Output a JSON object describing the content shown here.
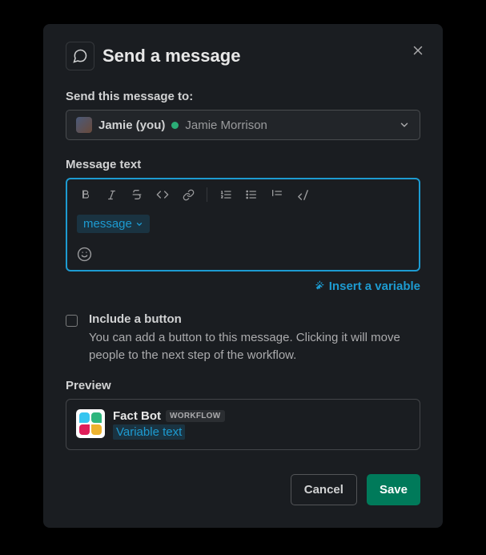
{
  "header": {
    "title": "Send a message"
  },
  "fields": {
    "recipient_label": "Send this message to:",
    "message_label": "Message text"
  },
  "recipient": {
    "display_name": "Jamie (you)",
    "full_name": "Jamie Morrison"
  },
  "editor": {
    "variable_chip": "message"
  },
  "actions": {
    "insert_variable": "Insert a variable"
  },
  "include_button": {
    "label": "Include a button",
    "description": "You can add a button to this message. Clicking it will move people to the next step of the workflow."
  },
  "preview": {
    "label": "Preview",
    "bot_name": "Fact Bot",
    "badge": "WORKFLOW",
    "variable_text": "Variable text"
  },
  "footer": {
    "cancel": "Cancel",
    "save": "Save"
  }
}
